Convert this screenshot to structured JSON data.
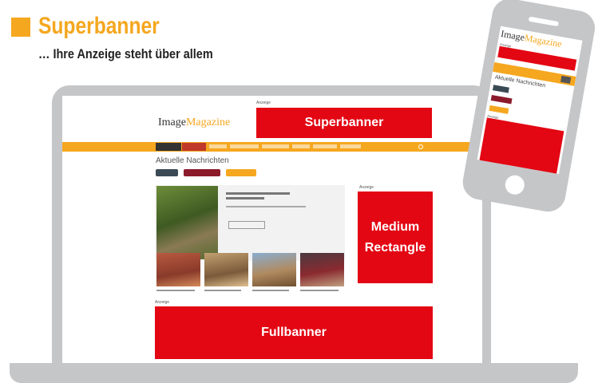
{
  "heading": {
    "title": "Superbanner",
    "subtitle": "… Ihre Anzeige steht über allem"
  },
  "laptop_screen": {
    "ad_label": "Anzeige",
    "logo": {
      "part1": "Image",
      "part2": "Magazine"
    },
    "superbanner": "Superbanner",
    "news_heading": "Aktuelle Nachrichten",
    "medium_rectangle": {
      "line1": "Medium",
      "line2": "Rectangle"
    },
    "fullbanner": "Fullbanner"
  },
  "phone_screen": {
    "logo": {
      "part1": "Image",
      "part2": "Magazine"
    },
    "ad_label": "Anzeige",
    "news_heading": "Aktuelle Nachrichten"
  },
  "colors": {
    "brand_orange": "#f5a71f",
    "ad_red": "#e30613",
    "device_gray": "#c5c6c8"
  }
}
